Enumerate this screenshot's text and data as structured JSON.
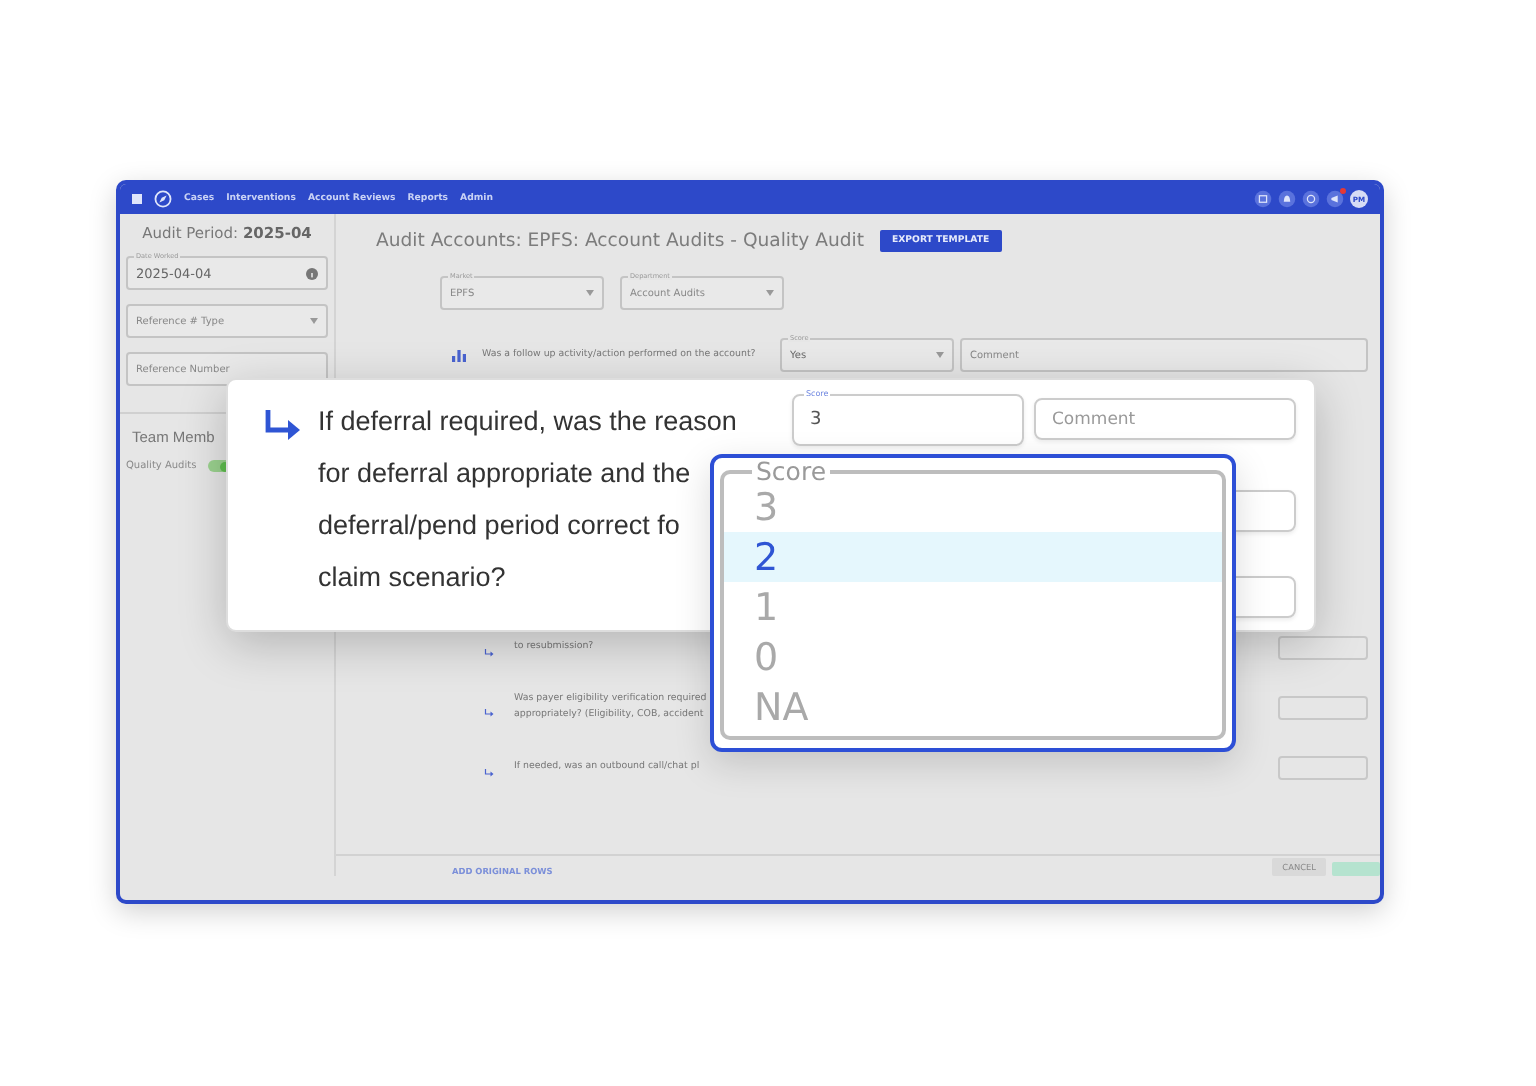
{
  "header": {
    "nav": [
      {
        "label": "Cases"
      },
      {
        "label": "Interventions"
      },
      {
        "label": "Account Reviews"
      },
      {
        "label": "Reports"
      },
      {
        "label": "Admin"
      }
    ],
    "avatar": "PM",
    "notification_dot": true
  },
  "sidebar": {
    "audit_period_label": "Audit Period:",
    "audit_period": "2025-04",
    "date_worked": {
      "label": "Date Worked",
      "value": "2025-04-04"
    },
    "reference_type": {
      "placeholder": "Reference # Type"
    },
    "reference_number": {
      "placeholder": "Reference Number"
    },
    "team_heading": "Team Memb",
    "team_items": [
      {
        "label": "Quality Audits",
        "on": true
      }
    ]
  },
  "main": {
    "title": "Audit Accounts: EPFS: Account Audits - Quality Audit",
    "export_button": "EXPORT TEMPLATE",
    "filters": [
      {
        "label": "Market",
        "value": "EPFS"
      },
      {
        "label": "Department",
        "value": "Account Audits"
      }
    ],
    "questions": [
      {
        "kind": "top",
        "text": "Was a follow up activity/action performed on the account?",
        "score_label": "Score",
        "score": "Yes",
        "comment_placeholder": "Comment"
      },
      {
        "kind": "sub",
        "text": "to resubmission?"
      },
      {
        "kind": "sub",
        "text": "Was payer eligibility verification required\nappropriately? (Eligibility, COB, accident"
      },
      {
        "kind": "sub",
        "text": "If needed, was an outbound call/chat pl"
      }
    ],
    "add_rows": "ADD ORIGINAL ROWS",
    "cancel_button": "CANCEL"
  },
  "callout": {
    "question": "If deferral required, was the reason\nfor deferral appropriate and the\ndeferral/pend period correct fo\nclaim scenario?",
    "score_label": "Score",
    "score": "3",
    "comment_placeholder": "Comment"
  },
  "dropdown": {
    "legend": "Score",
    "options": [
      {
        "label": "3",
        "selected": false
      },
      {
        "label": "2",
        "selected": true
      },
      {
        "label": "1",
        "selected": false
      },
      {
        "label": "0",
        "selected": false
      },
      {
        "label": "NA",
        "selected": false
      }
    ]
  }
}
